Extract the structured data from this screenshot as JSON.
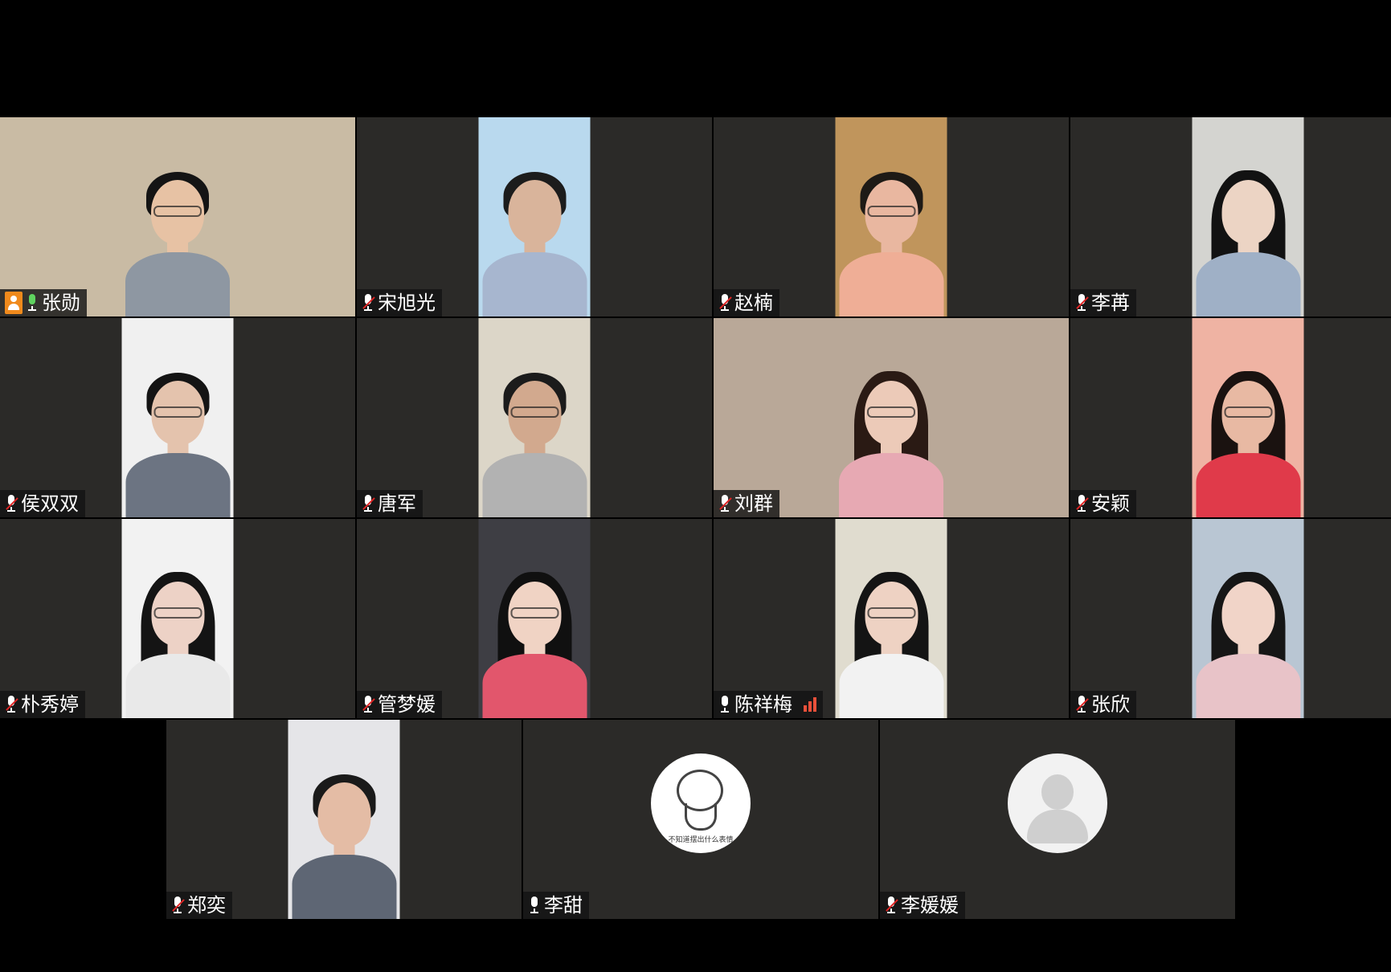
{
  "participants": [
    {
      "name": "张勋",
      "mic": "on",
      "host": true,
      "active": true,
      "video": "full",
      "bg": "#c9bba4",
      "skin": "#e7c2a4",
      "hair": "#141414",
      "shirt": "#8e97a2",
      "glasses": true
    },
    {
      "name": "宋旭光",
      "mic": "muted",
      "video": "portrait",
      "bg": "#b9d9ee",
      "skin": "#d9b49b",
      "hair": "#1c1c1c",
      "shirt": "#a7b6cf",
      "glasses": false
    },
    {
      "name": "赵楠",
      "mic": "muted",
      "video": "portrait",
      "bg": "#c0955c",
      "skin": "#e9b7a0",
      "hair": "#1e1a16",
      "shirt": "#efae96",
      "glasses": true
    },
    {
      "name": "李苒",
      "mic": "muted",
      "video": "portrait",
      "bg": "#d4d4d0",
      "skin": "#ecd4c4",
      "hair": "#121212",
      "shirt": "#9fb0c6",
      "glasses": false,
      "long": true
    },
    {
      "name": "侯双双",
      "mic": "muted",
      "video": "portrait",
      "bg": "#f0f0f0",
      "skin": "#e4c3ad",
      "hair": "#141414",
      "shirt": "#6c7482",
      "glasses": true
    },
    {
      "name": "唐军",
      "mic": "muted",
      "video": "portrait",
      "bg": "#dcd6c8",
      "skin": "#d2a98e",
      "hair": "#1b1b1b",
      "shirt": "#b2b2b2",
      "glasses": true
    },
    {
      "name": "刘群",
      "mic": "muted",
      "video": "full",
      "bg": "#b9a898",
      "skin": "#eccab8",
      "hair": "#2a1a14",
      "shirt": "#e7a9b3",
      "glasses": true,
      "long": true
    },
    {
      "name": "安颖",
      "mic": "muted",
      "video": "portrait",
      "bg": "#efb3a3",
      "skin": "#e8b9a3",
      "hair": "#1a1210",
      "shirt": "#e03a4a",
      "glasses": true,
      "long": true
    },
    {
      "name": "朴秀婷",
      "mic": "muted",
      "video": "portrait",
      "bg": "#f2f2f2",
      "skin": "#edd2c6",
      "hair": "#141414",
      "shirt": "#e9e9e9",
      "glasses": true,
      "long": true
    },
    {
      "name": "管梦媛",
      "mic": "muted",
      "video": "portrait",
      "bg": "#3e3e44",
      "skin": "#f0d3c4",
      "hair": "#101010",
      "shirt": "#e2566c",
      "glasses": true,
      "long": true
    },
    {
      "name": "陈祥梅",
      "mic": "speaking",
      "video": "portrait",
      "bg": "#e0dccf",
      "skin": "#eed2c3",
      "hair": "#141414",
      "shirt": "#f2f2f2",
      "glasses": true,
      "long": true,
      "signal": true
    },
    {
      "name": "张欣",
      "mic": "muted",
      "video": "portrait",
      "bg": "#b9c6d3",
      "skin": "#f1d4c8",
      "hair": "#161616",
      "shirt": "#e8c3c8",
      "glasses": false,
      "long": true
    },
    {
      "name": "郑奕",
      "mic": "muted",
      "video": "portrait",
      "bg": "#e5e5e8",
      "skin": "#e4bca5",
      "hair": "#1a1a1a",
      "shirt": "#5e6674",
      "glasses": false
    },
    {
      "name": "李甜",
      "mic": "speaking",
      "video": "none",
      "avatar": "cartoon",
      "avatar_text": "不知道摆出什么表情"
    },
    {
      "name": "李媛媛",
      "mic": "muted",
      "video": "none",
      "avatar": "default"
    }
  ],
  "colors": {
    "active_outline": "#22c55e",
    "host_badge": "#f08a1c",
    "muted_slash": "#e02424",
    "signal": "#e8503a"
  }
}
